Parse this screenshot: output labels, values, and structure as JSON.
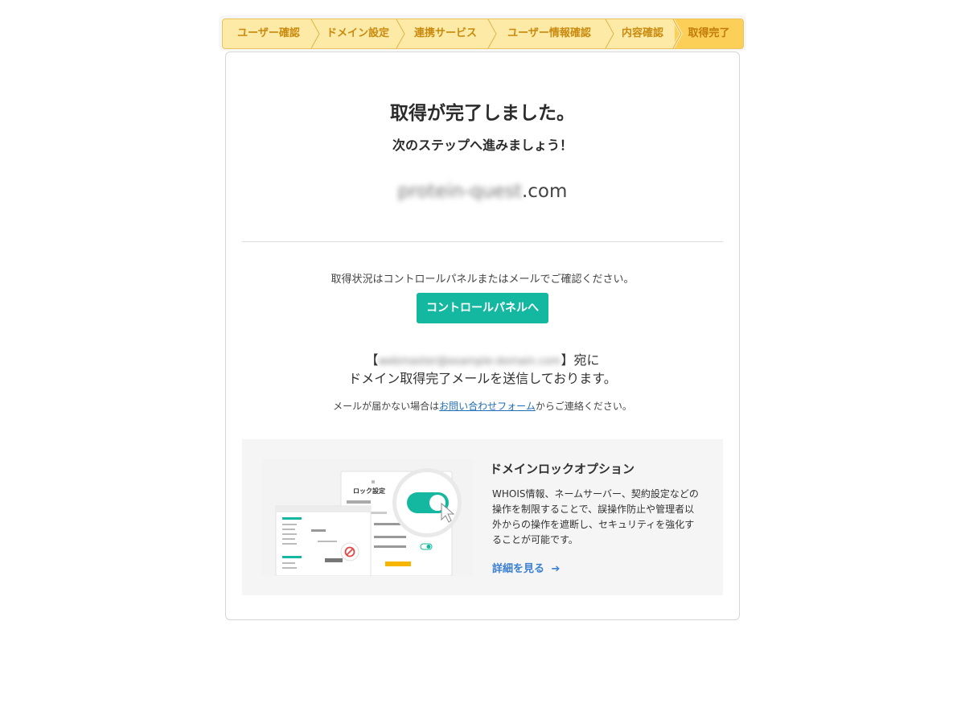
{
  "stepper": {
    "steps": [
      {
        "label": "ユーザー確認"
      },
      {
        "label": "ドメイン設定"
      },
      {
        "label": "連携サービス"
      },
      {
        "label": "ユーザー情報確認"
      },
      {
        "label": "内容確認"
      },
      {
        "label": "取得完了"
      }
    ],
    "active_index": 5
  },
  "main": {
    "title": "取得が完了しました。",
    "subtitle": "次のステップへ進みましょう！",
    "domain": {
      "name_blurred": "protein-quest",
      "tld": ".com"
    },
    "status_text": "取得状況はコントロールパネルまたはメールでご確認ください。",
    "control_panel_button": "コントロールパネルへ",
    "mail": {
      "open_bracket": "【",
      "address_blurred": "webmaster@example-domain.com",
      "close_suffix": "】宛に",
      "line2": "ドメイン取得完了メールを送信しております。"
    },
    "contact": {
      "prefix": "メールが届かない場合は",
      "link": "お問い合わせフォーム",
      "suffix": "からご連絡ください。"
    }
  },
  "lock_option": {
    "title": "ドメインロックオプション",
    "description": "WHOIS情報、ネームサーバー、契約設定などの操作を制限することで、誤操作防止や管理者以外からの操作を遮断し、セキュリティを強化することが可能です。",
    "more_link": "詳細を見る",
    "illustration_label": "ロック設定"
  },
  "colors": {
    "accent_teal": "#14b8a0",
    "step_bg": "#fdeaa6",
    "step_active_bg": "#fbcf58",
    "step_text": "#c98a0e",
    "link_blue": "#1f6fb8"
  }
}
